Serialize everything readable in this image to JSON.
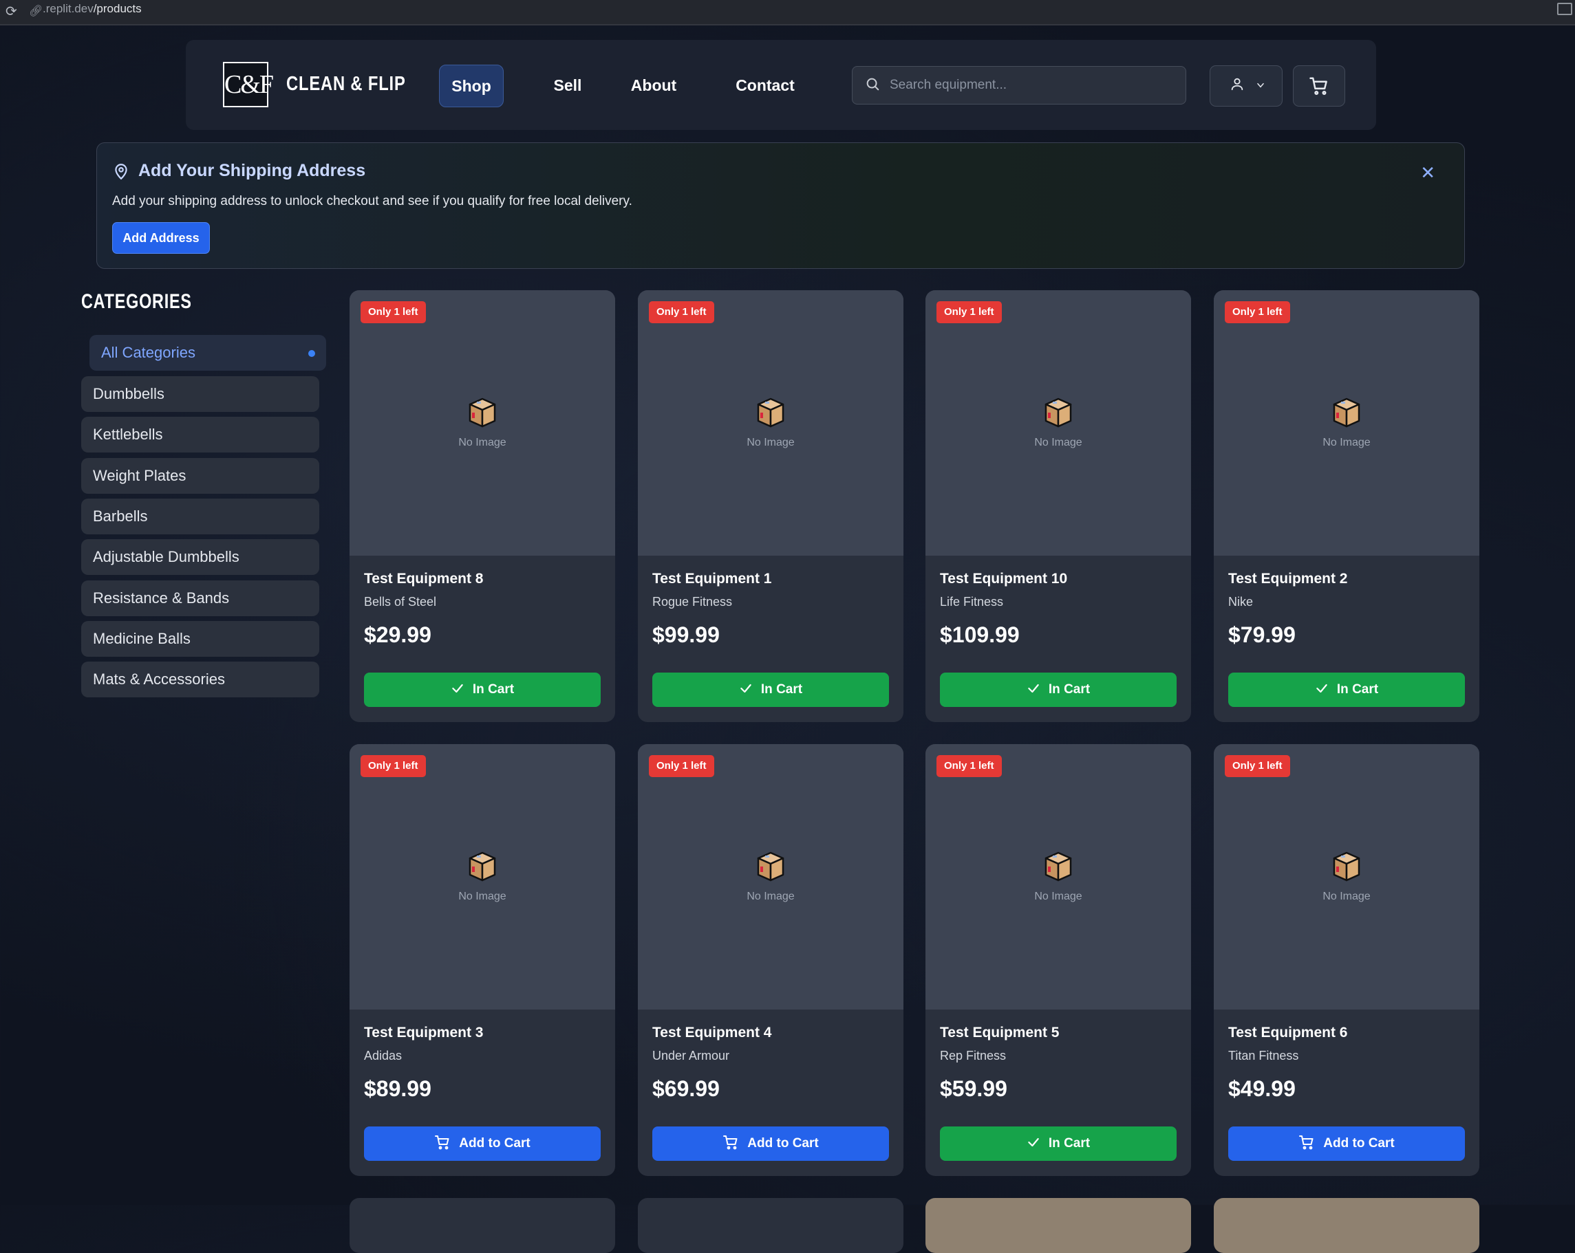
{
  "browser": {
    "url_prefix": ".replit.dev",
    "url_path": "/products"
  },
  "header": {
    "logo_text": "C&F",
    "brand": "CLEAN & FLIP",
    "nav": [
      {
        "label": "Shop",
        "active": true
      },
      {
        "label": "Sell",
        "active": false
      },
      {
        "label": "About",
        "active": false
      },
      {
        "label": "Contact",
        "active": false
      }
    ],
    "search_placeholder": "Search equipment..."
  },
  "banner": {
    "title": "Add Your Shipping Address",
    "text": "Add your shipping address to unlock checkout and see if you qualify for free local delivery.",
    "button": "Add Address",
    "close_glyph": "✕"
  },
  "sidebar": {
    "heading": "CATEGORIES",
    "items": [
      {
        "label": "All Categories",
        "active": true
      },
      {
        "label": "Dumbbells"
      },
      {
        "label": "Kettlebells"
      },
      {
        "label": "Weight Plates"
      },
      {
        "label": "Barbells"
      },
      {
        "label": "Adjustable Dumbbells"
      },
      {
        "label": "Resistance & Bands"
      },
      {
        "label": "Medicine Balls"
      },
      {
        "label": "Mats & Accessories"
      }
    ]
  },
  "products": [
    {
      "badge": "Only 1 left",
      "placeholder": "No Image",
      "name": "Test Equipment 8",
      "brand": "Bells of Steel",
      "price": "$29.99",
      "button": "In Cart",
      "in_cart": true
    },
    {
      "badge": "Only 1 left",
      "placeholder": "No Image",
      "name": "Test Equipment 1",
      "brand": "Rogue Fitness",
      "price": "$99.99",
      "button": "In Cart",
      "in_cart": true
    },
    {
      "badge": "Only 1 left",
      "placeholder": "No Image",
      "name": "Test Equipment 10",
      "brand": "Life Fitness",
      "price": "$109.99",
      "button": "In Cart",
      "in_cart": true
    },
    {
      "badge": "Only 1 left",
      "placeholder": "No Image",
      "name": "Test Equipment 2",
      "brand": "Nike",
      "price": "$79.99",
      "button": "In Cart",
      "in_cart": true
    },
    {
      "badge": "Only 1 left",
      "placeholder": "No Image",
      "name": "Test Equipment 3",
      "brand": "Adidas",
      "price": "$89.99",
      "button": "Add to Cart",
      "in_cart": false
    },
    {
      "badge": "Only 1 left",
      "placeholder": "No Image",
      "name": "Test Equipment 4",
      "brand": "Under Armour",
      "price": "$69.99",
      "button": "Add to Cart",
      "in_cart": false
    },
    {
      "badge": "Only 1 left",
      "placeholder": "No Image",
      "name": "Test Equipment 5",
      "brand": "Rep Fitness",
      "price": "$59.99",
      "button": "In Cart",
      "in_cart": true
    },
    {
      "badge": "Only 1 left",
      "placeholder": "No Image",
      "name": "Test Equipment 6",
      "brand": "Titan Fitness",
      "price": "$49.99",
      "button": "Add to Cart",
      "in_cart": false
    }
  ],
  "colors": {
    "accent": "#2563eb",
    "in_cart": "#16a34a",
    "badge": "#e53935",
    "background": "#0f1420"
  }
}
